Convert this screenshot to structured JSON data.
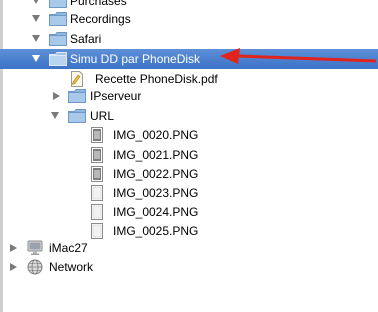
{
  "tree": {
    "items": [
      {
        "label": "Purchases"
      },
      {
        "label": "Recordings"
      },
      {
        "label": "Safari"
      },
      {
        "label": "Simu DD par PhoneDisk"
      },
      {
        "label": "Recette PhoneDisk.pdf"
      },
      {
        "label": "IPserveur"
      },
      {
        "label": "URL"
      },
      {
        "label": "IMG_0020.PNG"
      },
      {
        "label": "IMG_0021.PNG"
      },
      {
        "label": "IMG_0022.PNG"
      },
      {
        "label": "IMG_0023.PNG"
      },
      {
        "label": "IMG_0024.PNG"
      },
      {
        "label": "IMG_0025.PNG"
      },
      {
        "label": "iMac27"
      },
      {
        "label": "Network"
      }
    ]
  },
  "colors": {
    "selection": "#3b73c8",
    "folder": "#8fb7e0",
    "annotation_arrow": "#e0231c"
  }
}
